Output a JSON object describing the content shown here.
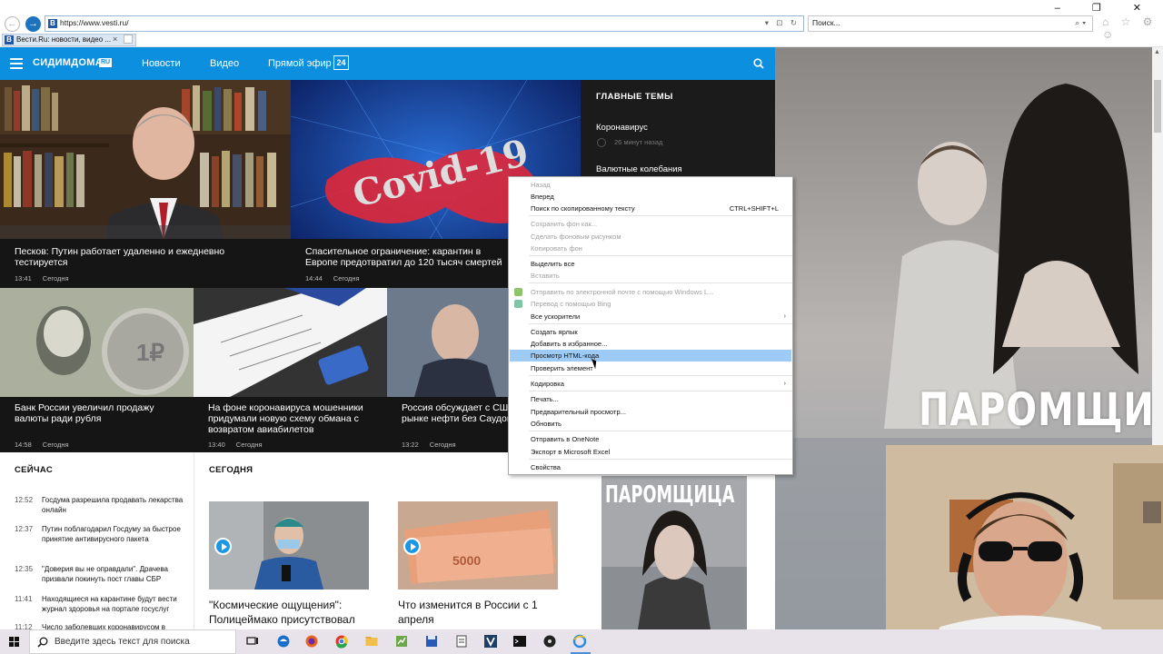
{
  "browser": {
    "url": "https://www.vesti.ru/",
    "favicon_letter": "B",
    "search_placeholder": "Поиск...",
    "tab_title": "Вести.Ru: новости, видео ...",
    "tab_close": "×",
    "window_controls": "– ❐ ✕",
    "addr_tools": "▾ ⊡ ↻",
    "search_tools": "⌕▾",
    "cmd_icons": "⌂ ☆ ⚙ ☺"
  },
  "site": {
    "logo": "СИДИМДОМА",
    "logo_suffix": "RU",
    "nav": [
      "Новости",
      "Видео",
      "Прямой эфир"
    ],
    "live_badge": "24"
  },
  "tiles": [
    {
      "caption": "Песков: Путин работает удаленно и ежедневно тестируется",
      "time": "13:41",
      "date": "Сегодня"
    },
    {
      "caption": "Спасительное ограничение: карантин в Европе предотвратил до 120 тысяч смертей",
      "time": "14:44",
      "date": "Сегодня",
      "image_text": "Covid-19"
    },
    {
      "caption": "Банк России увеличил продажу валюты ради рубля",
      "time": "14:58",
      "date": "Сегодня"
    },
    {
      "caption": "На фоне коронавируса мошенники придумали новую схему обмана с возвратом авиабилетов",
      "time": "13:40",
      "date": "Сегодня"
    },
    {
      "caption": "Россия обсуждает с США ситуацию на рынке нефти без Саудовской Аравии",
      "time": "13:22",
      "date": "Сегодня"
    }
  ],
  "themes": {
    "title": "ГЛАВНЫЕ ТЕМЫ",
    "items": [
      {
        "label": "Коронавирус",
        "meta": "26 минут назад"
      },
      {
        "label": "Валютные колебания"
      }
    ]
  },
  "now": {
    "title": "СЕЙЧАС",
    "items": [
      {
        "time": "12:52",
        "text": "Госдума разрешила продавать лекарства онлайн"
      },
      {
        "time": "12:37",
        "text": "Путин поблагодарил Госдуму за быстрое принятие антивирусного пакета"
      },
      {
        "time": "12:35",
        "text": "\"Доверия вы не оправдали\". Драчева призвали покинуть пост главы СБР"
      },
      {
        "time": "11:41",
        "text": "Находящиеся на карантине будут вести журнал здоровья на портале госуслуг"
      },
      {
        "time": "11:12",
        "text": "Число заболевших коронавирусом в"
      }
    ]
  },
  "today": {
    "title": "СЕГОДНЯ",
    "cards": [
      {
        "text": "\"Космические ощущения\": Полицеймако присутствовал"
      },
      {
        "text": "Что изменится в России с 1 апреля"
      }
    ]
  },
  "ads": {
    "big_title": "ПАРОМЩИЦА",
    "small_title": "ПАРОМЩИЦА"
  },
  "context_menu": {
    "items": [
      {
        "label": "Назад",
        "disabled": true
      },
      {
        "label": "Вперед",
        "disabled": false
      },
      {
        "label": "Поиск по скопированному тексту",
        "shortcut": "CTRL+SHIFT+L",
        "disabled": false
      },
      {
        "label": "Сохранить фон как...",
        "disabled": true
      },
      {
        "label": "Сделать фоновым рисунком",
        "disabled": true
      },
      {
        "label": "Копировать фон",
        "disabled": true
      },
      {
        "label": "Выделить все",
        "disabled": false
      },
      {
        "label": "Вставить",
        "disabled": true
      },
      {
        "label": "Отправить по электронной почте с помощью Windows L...",
        "disabled": true
      },
      {
        "label": "Перевод с помощью Bing",
        "disabled": true
      },
      {
        "label": "Все ускорители",
        "disabled": false,
        "submenu": true
      },
      {
        "label": "Создать ярлык",
        "disabled": false
      },
      {
        "label": "Добавить в избранное...",
        "disabled": false
      },
      {
        "label": "Просмотр HTML-кода",
        "disabled": false,
        "highlighted": true
      },
      {
        "label": "Проверить элемент",
        "disabled": false
      },
      {
        "label": "Кодировка",
        "disabled": false,
        "submenu": true
      },
      {
        "label": "Печать...",
        "disabled": false
      },
      {
        "label": "Предварительный просмотр...",
        "disabled": false
      },
      {
        "label": "Обновить",
        "disabled": false
      },
      {
        "label": "Отправить в OneNote",
        "disabled": false
      },
      {
        "label": "Экспорт в Microsoft Excel",
        "disabled": false
      },
      {
        "label": "Свойства",
        "disabled": false
      }
    ]
  },
  "taskbar": {
    "search_placeholder": "Введите здесь текст для поиска"
  },
  "colors": {
    "brand_blue": "#0d8fe0",
    "menu_highlight": "#9dcbf6",
    "dark_panel": "#1b1b1b"
  }
}
